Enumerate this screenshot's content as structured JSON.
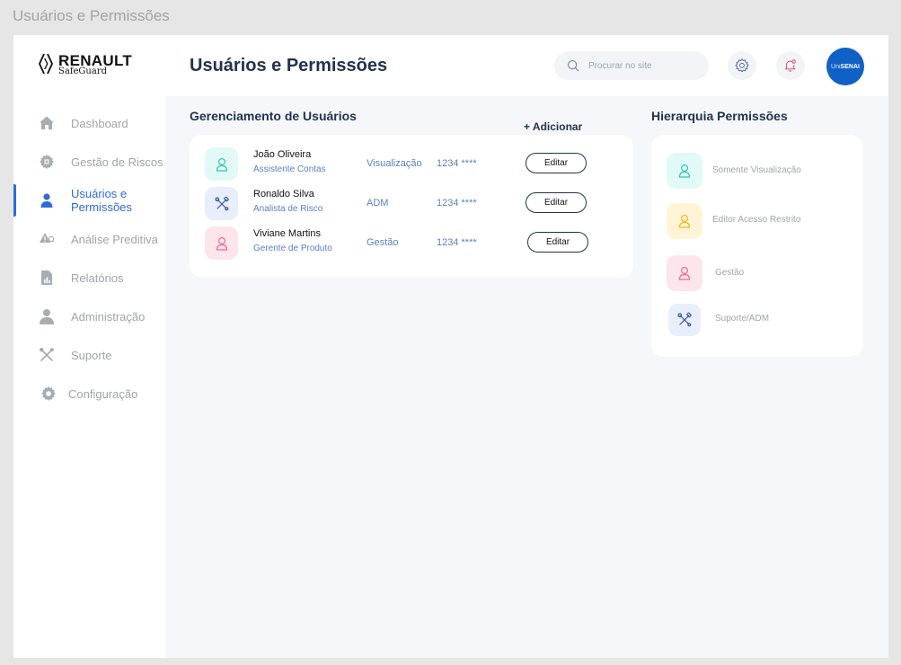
{
  "window": {
    "title": "Usuários e Permissões"
  },
  "header": {
    "logo_brand": "RENAULT",
    "logo_sub": "SafeGuard",
    "page_title": "Usuários e Permissões",
    "search_placeholder": "Procurar no site",
    "avatar_prefix": "Uni",
    "avatar_text": "SENAI"
  },
  "sidebar": {
    "items": [
      {
        "label": "Dashboard",
        "icon": "home-icon",
        "active": false
      },
      {
        "label": "Gestão de Riscos",
        "icon": "cog-risk-icon",
        "active": false
      },
      {
        "label": "Usuários e Permissões",
        "icon": "user-icon",
        "active": true
      },
      {
        "label": "Análise Preditiva",
        "icon": "warning-search-icon",
        "active": false
      },
      {
        "label": "Relatórios",
        "icon": "report-icon",
        "active": false
      },
      {
        "label": "Administração",
        "icon": "admin-user-icon",
        "active": false
      },
      {
        "label": "Suporte",
        "icon": "tools-icon",
        "active": false
      },
      {
        "label": "Configuração",
        "icon": "gear-icon",
        "active": false
      }
    ]
  },
  "users_section": {
    "title": "Gerenciamento de Usuários",
    "add_label": "+ Adicionar",
    "rows": [
      {
        "name": "João Oliveira",
        "role": "Assistente Contas",
        "permission": "Visualização",
        "password": "1234 ****",
        "edit_label": "Editar",
        "icon": "user-icon",
        "color": "#2ec4b6"
      },
      {
        "name": "Ronaldo Silva",
        "role": "Analista de Risco",
        "permission": "ADM",
        "password": "1234 ****",
        "edit_label": "Editar",
        "icon": "tools-icon",
        "color": "#3d5a98"
      },
      {
        "name": "Viviane Martins",
        "role": "Gerente de Produto",
        "permission": "Gestão",
        "password": "1234 ****",
        "edit_label": "Editar",
        "icon": "user-icon",
        "color": "#f06a8f"
      }
    ]
  },
  "permissions_section": {
    "title": "Hierarquia Permissões",
    "items": [
      {
        "label": "Somente Visualização",
        "icon": "user-icon",
        "color": "#2ec4b6"
      },
      {
        "label": "Editor Acesso Restrito",
        "icon": "user-icon",
        "color": "#f2b822"
      },
      {
        "label": "Gestão",
        "icon": "user-icon",
        "color": "#f06a8f"
      },
      {
        "label": "Suporte/ADM",
        "icon": "tools-icon",
        "color": "#3d5a98"
      }
    ]
  },
  "colors": {
    "accent": "#2f6bd8",
    "title": "#24324f",
    "muted": "#a0a4ab",
    "link": "#5b7fc2",
    "avatar": "#1061c6"
  }
}
